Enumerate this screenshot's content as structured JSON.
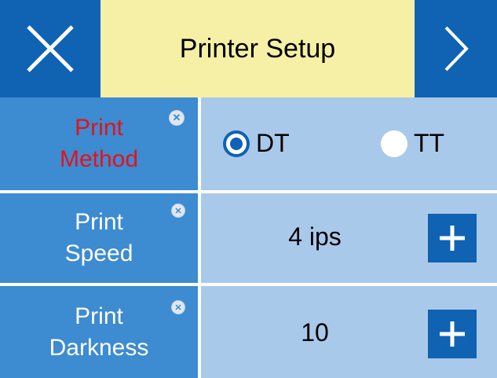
{
  "header": {
    "title": "Printer Setup",
    "close_icon": "close-x-icon",
    "next_icon": "chevron-right-icon"
  },
  "rows": {
    "method": {
      "label_line1": "Print",
      "label_line2": "Method",
      "options": [
        "DT",
        "TT"
      ],
      "selected": "DT"
    },
    "speed": {
      "label_line1": "Print",
      "label_line2": "Speed",
      "value": "4 ips"
    },
    "darkness": {
      "label_line1": "Print",
      "label_line2": "Darkness",
      "value": "10"
    }
  },
  "colors": {
    "button_blue": "#1062b3",
    "label_blue": "#3d8bd0",
    "value_bg": "#a9c9ea",
    "title_bg": "#f6efa6",
    "highlight_red": "#e5121b"
  }
}
